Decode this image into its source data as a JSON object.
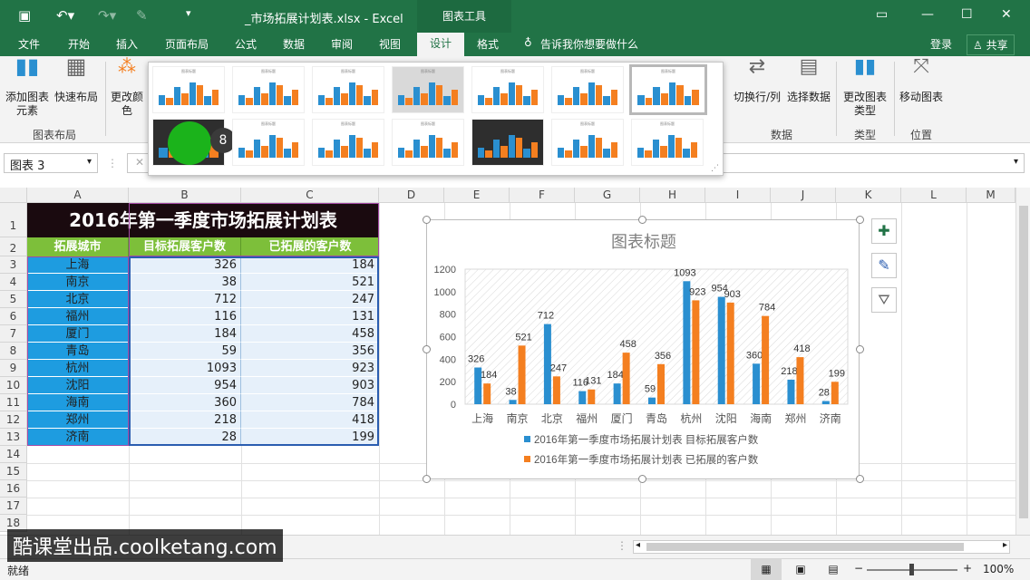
{
  "window": {
    "title": "_市场拓展计划表.xlsx - Excel",
    "chart_tools": "图表工具"
  },
  "menu": [
    "文件",
    "开始",
    "插入",
    "页面布局",
    "公式",
    "数据",
    "审阅",
    "视图",
    "设计",
    "格式"
  ],
  "tell_me": "告诉我你想要做什么",
  "login": "登录",
  "share": "共享",
  "ribbon": {
    "add_element": "添加图表元素",
    "quick_layout": "快速布局",
    "change_colors": "更改颜色",
    "group_layout": "图表布局",
    "switch_row_col": "切换行/列",
    "select_data": "选择数据",
    "group_data": "数据",
    "change_type": "更改图表类型",
    "group_type": "类型",
    "move_chart": "移动图表",
    "group_location": "位置",
    "gallery_badge": "8"
  },
  "name_box": "图表 3",
  "columns": [
    "A",
    "B",
    "C",
    "D",
    "E",
    "F",
    "G",
    "H",
    "I",
    "J",
    "K",
    "L",
    "M"
  ],
  "rows": [
    "1",
    "2",
    "3",
    "4",
    "5",
    "6",
    "7",
    "8",
    "9",
    "10",
    "11",
    "12",
    "13",
    "14",
    "15",
    "16",
    "17",
    "18"
  ],
  "sheet": {
    "title": "2016年第一季度市场拓展计划表",
    "headers": [
      "拓展城市",
      "目标拓展客户数",
      "已拓展的客户数"
    ],
    "cities": [
      "上海",
      "南京",
      "北京",
      "福州",
      "厦门",
      "青岛",
      "杭州",
      "沈阳",
      "海南",
      "郑州",
      "济南"
    ],
    "target": [
      326,
      38,
      712,
      116,
      184,
      59,
      1093,
      954,
      360,
      218,
      28
    ],
    "done": [
      184,
      521,
      247,
      131,
      458,
      356,
      923,
      903,
      784,
      418,
      199
    ]
  },
  "chart_data": {
    "type": "bar",
    "title": "图表标题",
    "categories": [
      "上海",
      "南京",
      "北京",
      "福州",
      "厦门",
      "青岛",
      "杭州",
      "沈阳",
      "海南",
      "郑州",
      "济南"
    ],
    "series": [
      {
        "name": "2016年第一季度市场拓展计划表 目标拓展客户数",
        "values": [
          326,
          38,
          712,
          116,
          184,
          59,
          1093,
          954,
          360,
          218,
          28
        ],
        "color": "#2a8fd0"
      },
      {
        "name": "2016年第一季度市场拓展计划表 已拓展的客户数",
        "values": [
          184,
          521,
          247,
          131,
          458,
          356,
          923,
          903,
          784,
          418,
          199
        ],
        "color": "#f47f20"
      }
    ],
    "ylim": [
      0,
      1200
    ],
    "yticks": [
      "0",
      "200",
      "400",
      "600",
      "800",
      "1000",
      "1200"
    ],
    "legend": "bottom"
  },
  "status": {
    "ready": "就绪",
    "zoom": "100%"
  },
  "watermark": "酷课堂出品.coolketang.com"
}
